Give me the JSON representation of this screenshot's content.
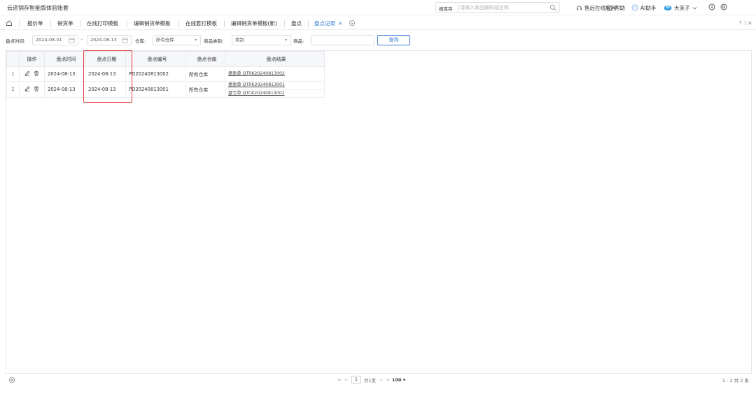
{
  "app": {
    "title": "云进销存智能版体验账套"
  },
  "search": {
    "prefix": "搜库存",
    "placeholder": "请输入商品编码或名称"
  },
  "topnav": {
    "service": "售后在线服务",
    "help": "帮助",
    "ai": "AI助手",
    "user": "大芙子"
  },
  "tabs": [
    {
      "label": "报价单"
    },
    {
      "label": "销货单"
    },
    {
      "label": "在线打印模板"
    },
    {
      "label": "编辑销货单模板"
    },
    {
      "label": "在线套打模板"
    },
    {
      "label": "编辑销货单模板(新)"
    },
    {
      "label": "盘点"
    },
    {
      "label": "盘点记录",
      "active": true
    }
  ],
  "tab_close": "×",
  "tab_right": "↑ | ⇲",
  "filters": {
    "time_label": "盘点时间:",
    "date_from": "2024-08-01",
    "date_to": "2024-08-13",
    "dash": "-",
    "warehouse_label": "仓库:",
    "warehouse_value": "所有仓库",
    "category_label": "商品类别:",
    "category_value": "类别",
    "product_label": "商品:",
    "product_value": "",
    "query_label": "查询"
  },
  "grid": {
    "columns": [
      "操作",
      "盘点时间",
      "盘点日期",
      "盘点编号",
      "盘点仓库",
      "盘点结果"
    ],
    "rows": [
      {
        "idx": "1",
        "time": "2024-08-13",
        "date": "2024-08-13",
        "no": "PD20240813002",
        "warehouse": "所有仓库",
        "results": [
          "盘盈单 QTRK20240813002"
        ]
      },
      {
        "idx": "2",
        "time": "2024-08-13",
        "date": "2024-08-13",
        "no": "PD20240813001",
        "warehouse": "所有仓库",
        "results": [
          "盘盈单 QTRK20240813001",
          "盘亏单 QTCK20240813001"
        ]
      }
    ]
  },
  "pager": {
    "first": "⇤",
    "prev": "⇠",
    "page": "1",
    "total_pages": "共1页",
    "next": "⇢",
    "last": "⇥",
    "page_size": "100 ▾",
    "count": "1 - 2  共 2 条"
  },
  "colors": {
    "accent": "#3a7bd5",
    "highlight": "#e23b3b"
  }
}
